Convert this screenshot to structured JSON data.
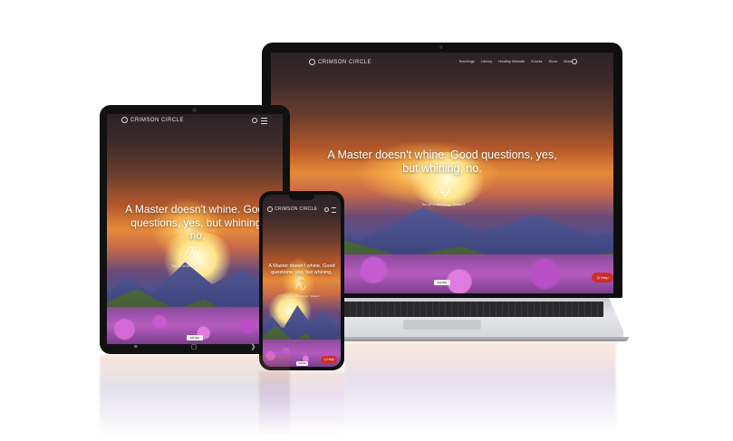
{
  "brand": "CRIMSON CIRCLE",
  "quote": "A Master doesn't whine. Good questions, yes, but whining, no.",
  "quote_mobile": "A Master doesn't whine. Good questions, yes, but whining, no.",
  "caption": "The Art of Becoming - Shaud 3",
  "button_label": "ENTER",
  "help_label": "Help",
  "nav": {
    "items": [
      "Teachings",
      "Library",
      "Healthy Website",
      "Events",
      "Store",
      "More"
    ]
  },
  "icons": [
    "search-icon",
    "menu-icon",
    "camera-icon",
    "help-icon",
    "signature-icon"
  ],
  "colors": {
    "help_red": "#c9302c",
    "frame": "#1a1a1a",
    "laptop_base": "#d9dadd"
  }
}
